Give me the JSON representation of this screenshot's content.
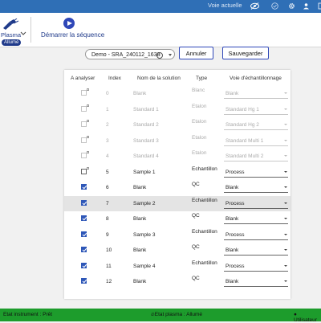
{
  "topbar": {
    "voie_label": "Voie actuelle"
  },
  "toolbar": {
    "plasma_label": "Plasma",
    "plasma_badge": "Allumé",
    "start_label": "Démarrer la séquence"
  },
  "sequence": {
    "selected": "Demo - SRA_240112_1638",
    "annuler": "Annuler",
    "sauvegarder": "Sauvegarder"
  },
  "table": {
    "headers": [
      "A analyser",
      "Index",
      "Nom de la solution",
      "Type",
      "Voie d'échantillonnage"
    ],
    "rows": [
      {
        "index": "0",
        "name": "Blank",
        "type": "Blanc",
        "voie": "Blank",
        "checked": false,
        "disabled": true
      },
      {
        "index": "1",
        "name": "Standard 1",
        "type": "Etalon",
        "voie": "Standard Hg 1",
        "checked": false,
        "disabled": true
      },
      {
        "index": "2",
        "name": "Standard 2",
        "type": "Etalon",
        "voie": "Standard Hg 2",
        "checked": false,
        "disabled": true
      },
      {
        "index": "3",
        "name": "Standard 3",
        "type": "Etalon",
        "voie": "Standard Multi 1",
        "checked": false,
        "disabled": true
      },
      {
        "index": "4",
        "name": "Standard 4",
        "type": "Etalon",
        "voie": "Standard Multi 2",
        "checked": false,
        "disabled": true
      },
      {
        "index": "5",
        "name": "Sample 1",
        "type": "Echantillon",
        "voie": "Process",
        "checked": false,
        "disabled": false
      },
      {
        "index": "6",
        "name": "Blank",
        "type": "QC",
        "voie": "Blank",
        "checked": true,
        "disabled": false
      },
      {
        "index": "7",
        "name": "Sample 2",
        "type": "Echantillon",
        "voie": "Process",
        "checked": true,
        "disabled": false,
        "selected": true
      },
      {
        "index": "8",
        "name": "Blank",
        "type": "QC",
        "voie": "Blank",
        "checked": true,
        "disabled": false
      },
      {
        "index": "9",
        "name": "Sample 3",
        "type": "Echantillon",
        "voie": "Process",
        "checked": true,
        "disabled": false
      },
      {
        "index": "10",
        "name": "Blank",
        "type": "QC",
        "voie": "Blank",
        "checked": true,
        "disabled": false
      },
      {
        "index": "11",
        "name": "Sample 4",
        "type": "Echantillon",
        "voie": "Process",
        "checked": true,
        "disabled": false
      },
      {
        "index": "12",
        "name": "Blank",
        "type": "QC",
        "voie": "Blank",
        "checked": true,
        "disabled": false
      }
    ]
  },
  "status": {
    "instrument": "Etat instrument : Prêt",
    "plasma": "Etat plasma : Allumé",
    "user": "Utilisateur"
  },
  "colors": {
    "topbar": "#2f6fb6",
    "accent": "#2f47b8",
    "statusbar": "#1d9c2c",
    "checkbox": "#2e57b8"
  },
  "icons": [
    "plasma-torch-icon",
    "chevron-down-icon",
    "play-icon",
    "eye-off-icon",
    "check-circle-icon",
    "gear-icon",
    "user-icon",
    "info-icon",
    "caret-down-icon",
    "flame-icon"
  ]
}
